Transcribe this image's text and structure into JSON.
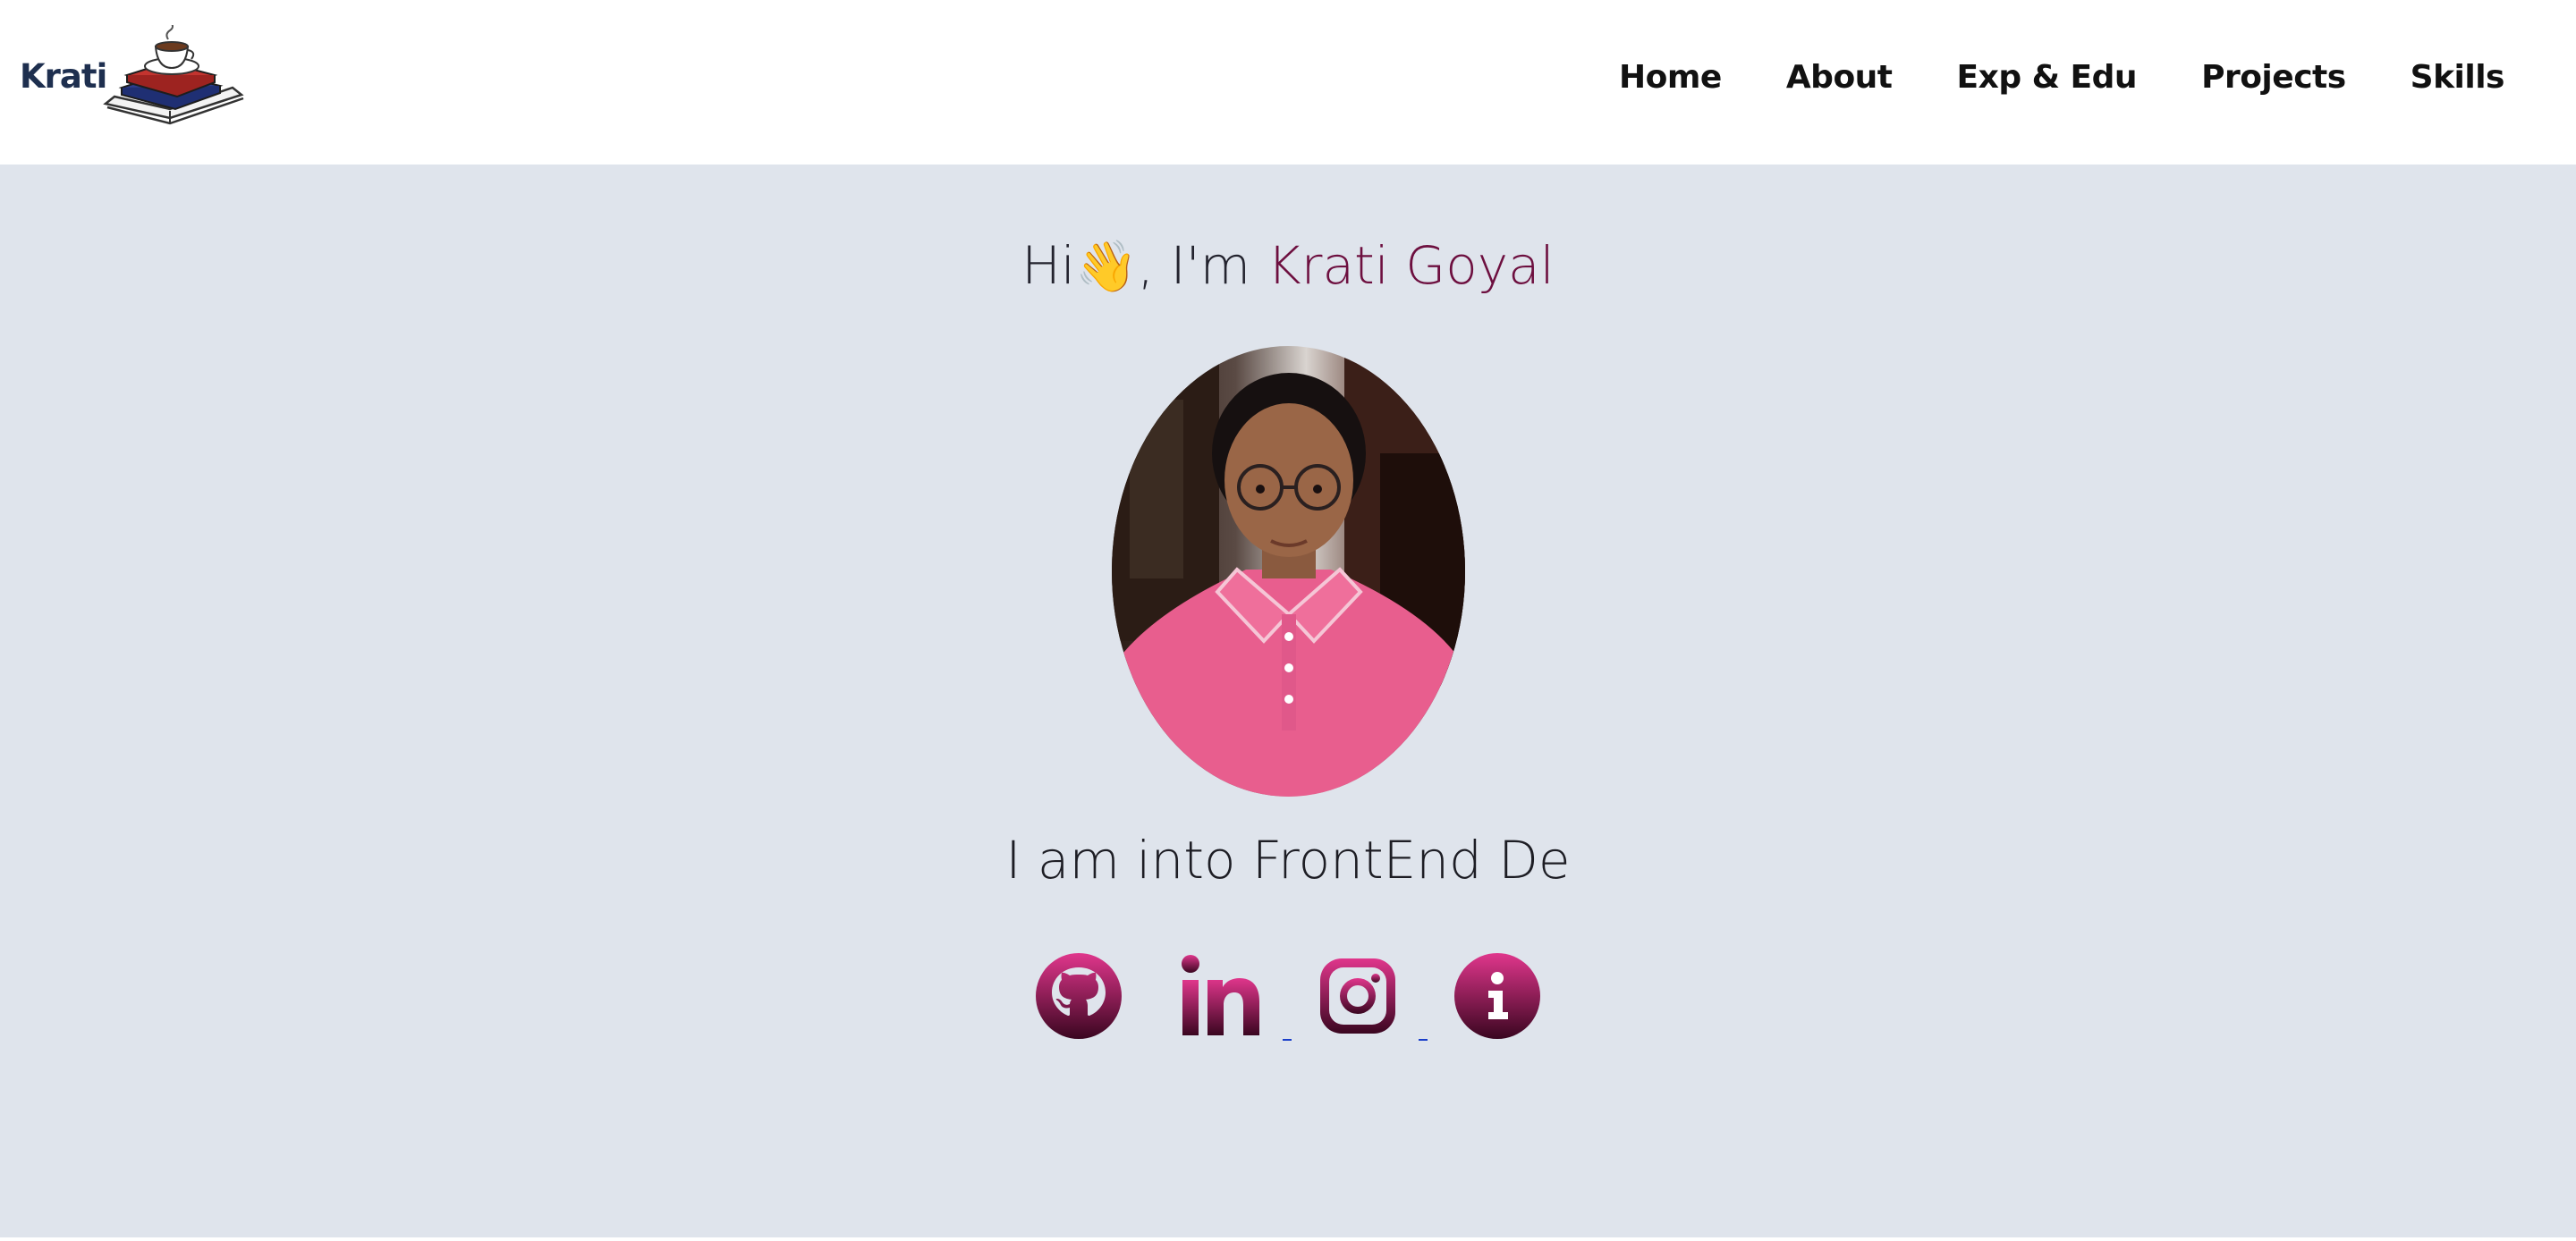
{
  "brand": {
    "logo_text": "Krati",
    "logo_icon": "books-coffee-cup-icon"
  },
  "nav": {
    "items": [
      {
        "label": "Home"
      },
      {
        "label": "About"
      },
      {
        "label": "Exp & Edu"
      },
      {
        "label": "Projects"
      },
      {
        "label": "Skills"
      }
    ]
  },
  "hero": {
    "greeting_prefix": "Hi",
    "greeting_emoji": "👋",
    "greeting_middle": ", I'm ",
    "name": "Krati Goyal",
    "portrait_icon": "profile-photo",
    "tagline": "I am into FrontEnd De"
  },
  "socials": [
    {
      "icon": "github-icon"
    },
    {
      "icon": "linkedin-icon"
    },
    {
      "icon": "instagram-icon"
    },
    {
      "icon": "info-icon"
    }
  ],
  "colors": {
    "background": "#dfe4ec",
    "navbar": "#ffffff",
    "name_accent": "#6d0f3f",
    "icon_gradient_top": "#e0368c",
    "icon_gradient_bottom": "#3a0620",
    "link_underline": "#1a3ec9"
  }
}
